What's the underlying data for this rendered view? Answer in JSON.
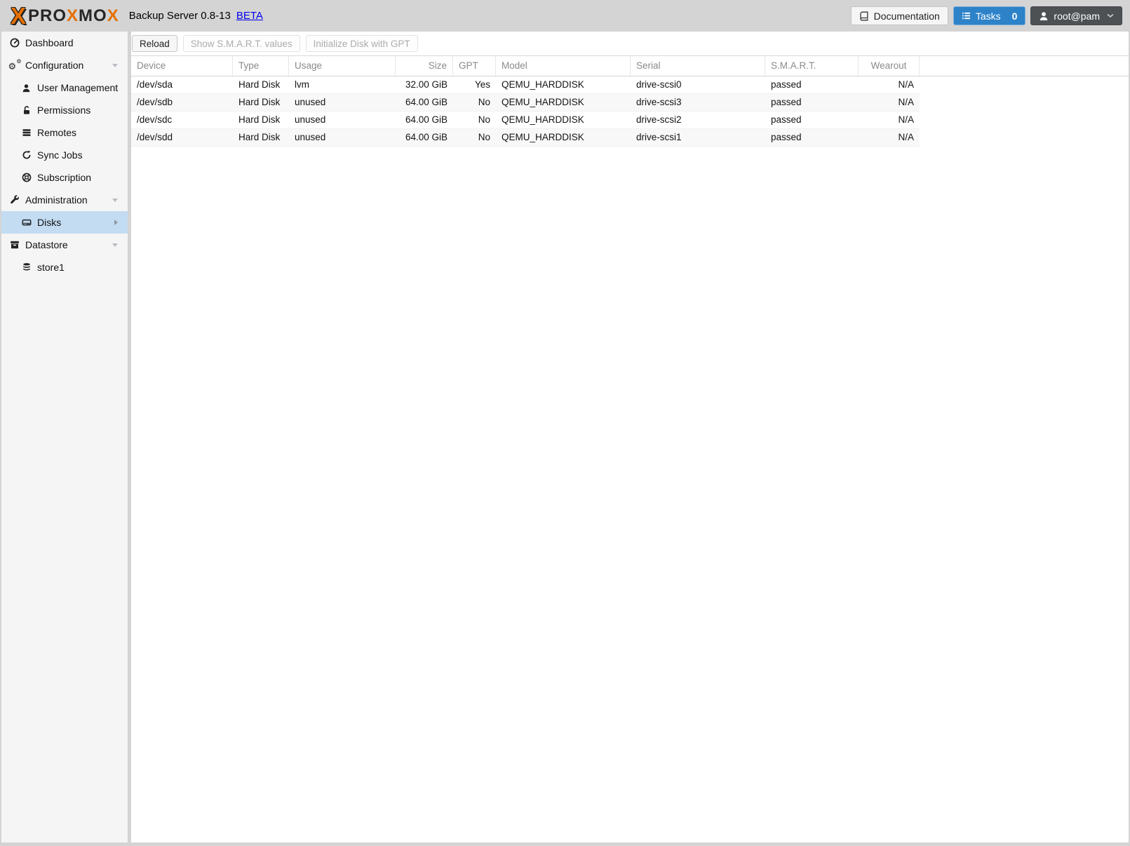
{
  "brand": {
    "mark": "X",
    "seg1": "PRO",
    "seg2": "X",
    "seg3": "MO",
    "seg4": "X",
    "title": "Backup Server 0.8-13",
    "beta": "BETA"
  },
  "header_buttons": {
    "documentation": "Documentation",
    "tasks": "Tasks",
    "tasks_count": "0",
    "user": "root@pam"
  },
  "sidebar": {
    "items": [
      {
        "label": "Dashboard"
      },
      {
        "label": "Configuration"
      },
      {
        "label": "User Management"
      },
      {
        "label": "Permissions"
      },
      {
        "label": "Remotes"
      },
      {
        "label": "Sync Jobs"
      },
      {
        "label": "Subscription"
      },
      {
        "label": "Administration"
      },
      {
        "label": "Disks"
      },
      {
        "label": "Datastore"
      },
      {
        "label": "store1"
      }
    ]
  },
  "toolbar": {
    "reload": "Reload",
    "show_smart": "Show S.M.A.R.T. values",
    "init_gpt": "Initialize Disk with GPT"
  },
  "table": {
    "columns": [
      "Device",
      "Type",
      "Usage",
      "Size",
      "GPT",
      "Model",
      "Serial",
      "S.M.A.R.T.",
      "Wearout"
    ],
    "rows": [
      {
        "device": "/dev/sda",
        "type": "Hard Disk",
        "usage": "lvm",
        "size": "32.00 GiB",
        "gpt": "Yes",
        "model": "QEMU_HARDDISK",
        "serial": "drive-scsi0",
        "smart": "passed",
        "wearout": "N/A"
      },
      {
        "device": "/dev/sdb",
        "type": "Hard Disk",
        "usage": "unused",
        "size": "64.00 GiB",
        "gpt": "No",
        "model": "QEMU_HARDDISK",
        "serial": "drive-scsi3",
        "smart": "passed",
        "wearout": "N/A"
      },
      {
        "device": "/dev/sdc",
        "type": "Hard Disk",
        "usage": "unused",
        "size": "64.00 GiB",
        "gpt": "No",
        "model": "QEMU_HARDDISK",
        "serial": "drive-scsi2",
        "smart": "passed",
        "wearout": "N/A"
      },
      {
        "device": "/dev/sdd",
        "type": "Hard Disk",
        "usage": "unused",
        "size": "64.00 GiB",
        "gpt": "No",
        "model": "QEMU_HARDDISK",
        "serial": "drive-scsi1",
        "smart": "passed",
        "wearout": "N/A"
      }
    ]
  },
  "colors": {
    "accent_blue": "#2d82c8",
    "brand_orange": "#e57000",
    "selection_blue": "#c3dcf2",
    "link_blue": "#0000ee"
  }
}
